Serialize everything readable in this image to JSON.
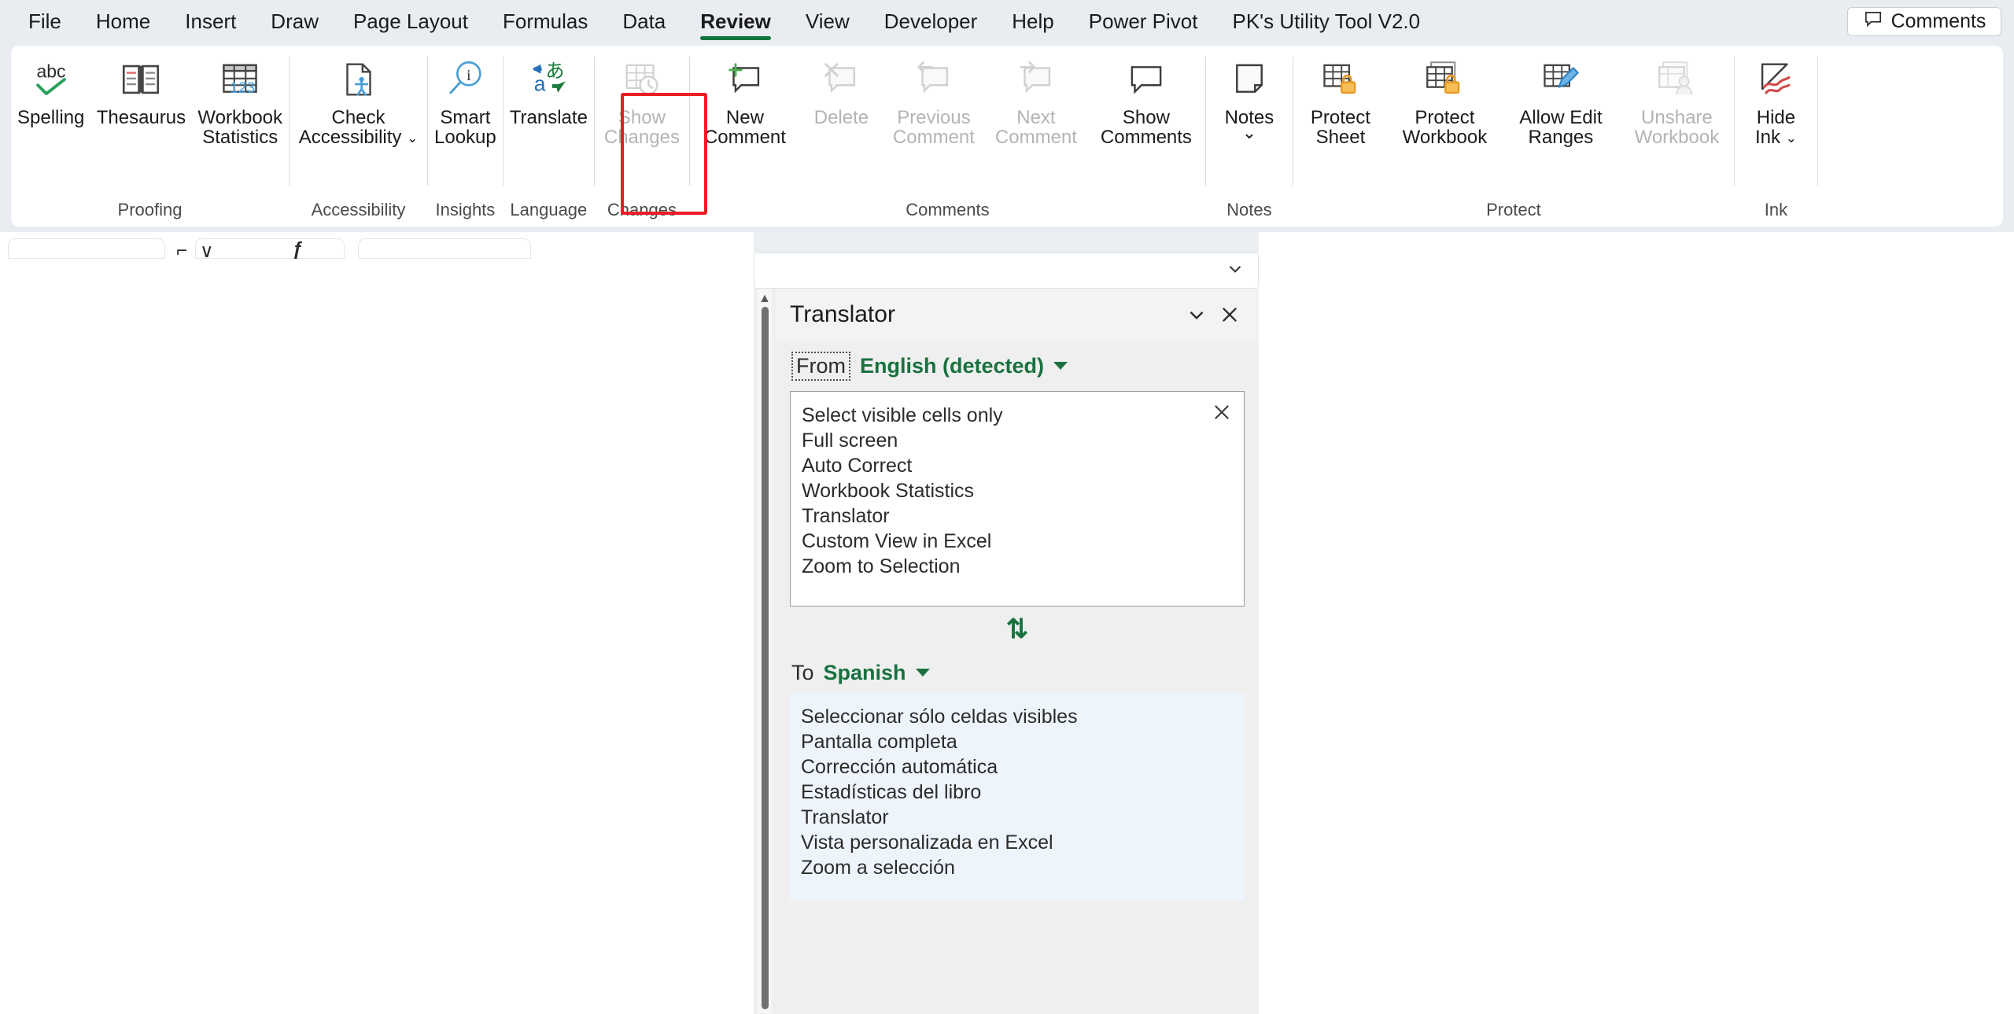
{
  "app": {
    "tabs": [
      {
        "label": "File",
        "active": false
      },
      {
        "label": "Home",
        "active": false
      },
      {
        "label": "Insert",
        "active": false
      },
      {
        "label": "Draw",
        "active": false
      },
      {
        "label": "Page Layout",
        "active": false
      },
      {
        "label": "Formulas",
        "active": false
      },
      {
        "label": "Data",
        "active": false
      },
      {
        "label": "Review",
        "active": true
      },
      {
        "label": "View",
        "active": false
      },
      {
        "label": "Developer",
        "active": false
      },
      {
        "label": "Help",
        "active": false
      },
      {
        "label": "Power Pivot",
        "active": false
      },
      {
        "label": "PK's Utility Tool V2.0",
        "active": false
      }
    ],
    "comments_button": "Comments"
  },
  "ribbon": {
    "groups": [
      {
        "name": "Proofing",
        "label": "Proofing",
        "buttons": [
          {
            "label": "Spelling",
            "icon": "spelling-abc-check-icon",
            "disabled": false
          },
          {
            "label": "Thesaurus",
            "icon": "thesaurus-book-icon",
            "disabled": false
          },
          {
            "label": "Workbook\nStatistics",
            "icon": "workbook-statistics-icon",
            "disabled": false
          }
        ]
      },
      {
        "name": "Accessibility",
        "label": "Accessibility",
        "buttons": [
          {
            "label": "Check\nAccessibility",
            "icon": "check-accessibility-icon",
            "disabled": false,
            "has_dropdown": true
          }
        ]
      },
      {
        "name": "Insights",
        "label": "Insights",
        "buttons": [
          {
            "label": "Smart\nLookup",
            "icon": "smart-lookup-magnifier-icon",
            "disabled": false
          }
        ]
      },
      {
        "name": "Language",
        "label": "Language",
        "buttons": [
          {
            "label": "Translate",
            "icon": "translate-icon",
            "disabled": false,
            "highlighted": true
          }
        ]
      },
      {
        "name": "Changes",
        "label": "Changes",
        "buttons": [
          {
            "label": "Show\nChanges",
            "icon": "show-changes-icon",
            "disabled": true
          }
        ]
      },
      {
        "name": "Comments",
        "label": "Comments",
        "buttons": [
          {
            "label": "New\nComment",
            "icon": "new-comment-icon",
            "disabled": false
          },
          {
            "label": "Delete",
            "icon": "delete-comment-icon",
            "disabled": true
          },
          {
            "label": "Previous\nComment",
            "icon": "previous-comment-icon",
            "disabled": true
          },
          {
            "label": "Next\nComment",
            "icon": "next-comment-icon",
            "disabled": true
          },
          {
            "label": "Show\nComments",
            "icon": "show-comments-icon",
            "disabled": false
          }
        ]
      },
      {
        "name": "Notes",
        "label": "Notes",
        "buttons": [
          {
            "label": "Notes",
            "icon": "notes-icon",
            "disabled": false,
            "has_dropdown": true
          }
        ]
      },
      {
        "name": "Protect",
        "label": "Protect",
        "buttons": [
          {
            "label": "Protect\nSheet",
            "icon": "protect-sheet-lock-icon",
            "disabled": false
          },
          {
            "label": "Protect\nWorkbook",
            "icon": "protect-workbook-lock-icon",
            "disabled": false
          },
          {
            "label": "Allow Edit\nRanges",
            "icon": "allow-edit-ranges-pencil-icon",
            "disabled": false
          },
          {
            "label": "Unshare\nWorkbook",
            "icon": "unshare-workbook-icon",
            "disabled": true
          }
        ]
      },
      {
        "name": "Ink",
        "label": "Ink",
        "buttons": [
          {
            "label": "Hide\nInk",
            "icon": "hide-ink-icon",
            "disabled": false,
            "has_dropdown": true
          }
        ]
      }
    ]
  },
  "translator": {
    "title": "Translator",
    "collapse_icon": "chevron-down-icon",
    "close_icon": "close-icon",
    "from": {
      "label": "From",
      "value": "English (detected)",
      "dropdown_icon": "caret-down-icon"
    },
    "source_text": [
      "Select visible cells only",
      "Full screen",
      "Auto Correct",
      "Workbook Statistics",
      "Translator",
      "Custom View in Excel",
      "Zoom to Selection"
    ],
    "clear_icon": "close-icon",
    "swap_icon": "swap-arrows-icon",
    "to": {
      "label": "To",
      "value": "Spanish",
      "dropdown_icon": "caret-down-icon"
    },
    "translated_text": [
      "Seleccionar sólo celdas visibles",
      "Pantalla completa",
      "Corrección automática",
      "Estadísticas del libro",
      "Translator",
      "Vista personalizada en Excel",
      "Zoom a selección"
    ],
    "colors": {
      "accent_green": "#19713f",
      "output_background": "#eef4fc",
      "highlight_red": "#ec1c24"
    }
  }
}
